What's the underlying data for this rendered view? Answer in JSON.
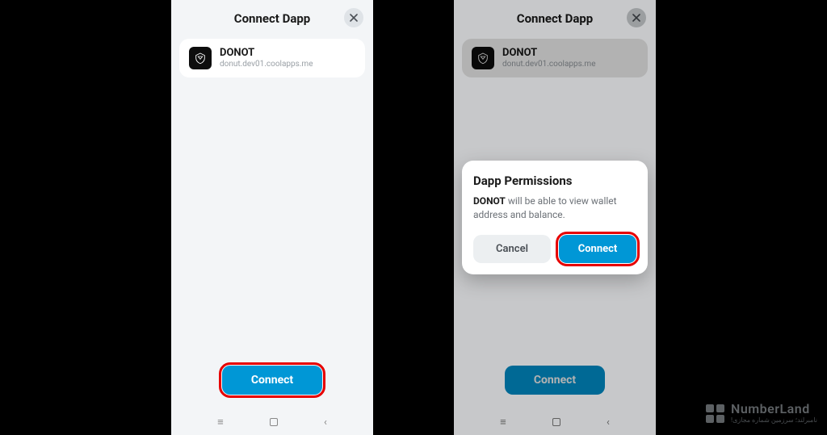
{
  "left": {
    "header_title": "Connect Dapp",
    "dapp": {
      "name": "DONOT",
      "domain": "donut.dev01.coolapps.me"
    },
    "connect_label": "Connect"
  },
  "right": {
    "header_title": "Connect Dapp",
    "dapp": {
      "name": "DONOT",
      "domain": "donut.dev01.coolapps.me"
    },
    "connect_label": "Connect",
    "permissions": {
      "title": "Dapp Permissions",
      "app_name": "DONOT",
      "desc_tail": " will be able to view wallet address and balance.",
      "cancel_label": "Cancel",
      "connect_label": "Connect"
    }
  },
  "watermark": {
    "brand": "NumberLand",
    "sub": "نامبرلند؛ سرزمین شماره مجازی!"
  },
  "colors": {
    "accent": "#0097d6",
    "highlight": "#e60000"
  }
}
